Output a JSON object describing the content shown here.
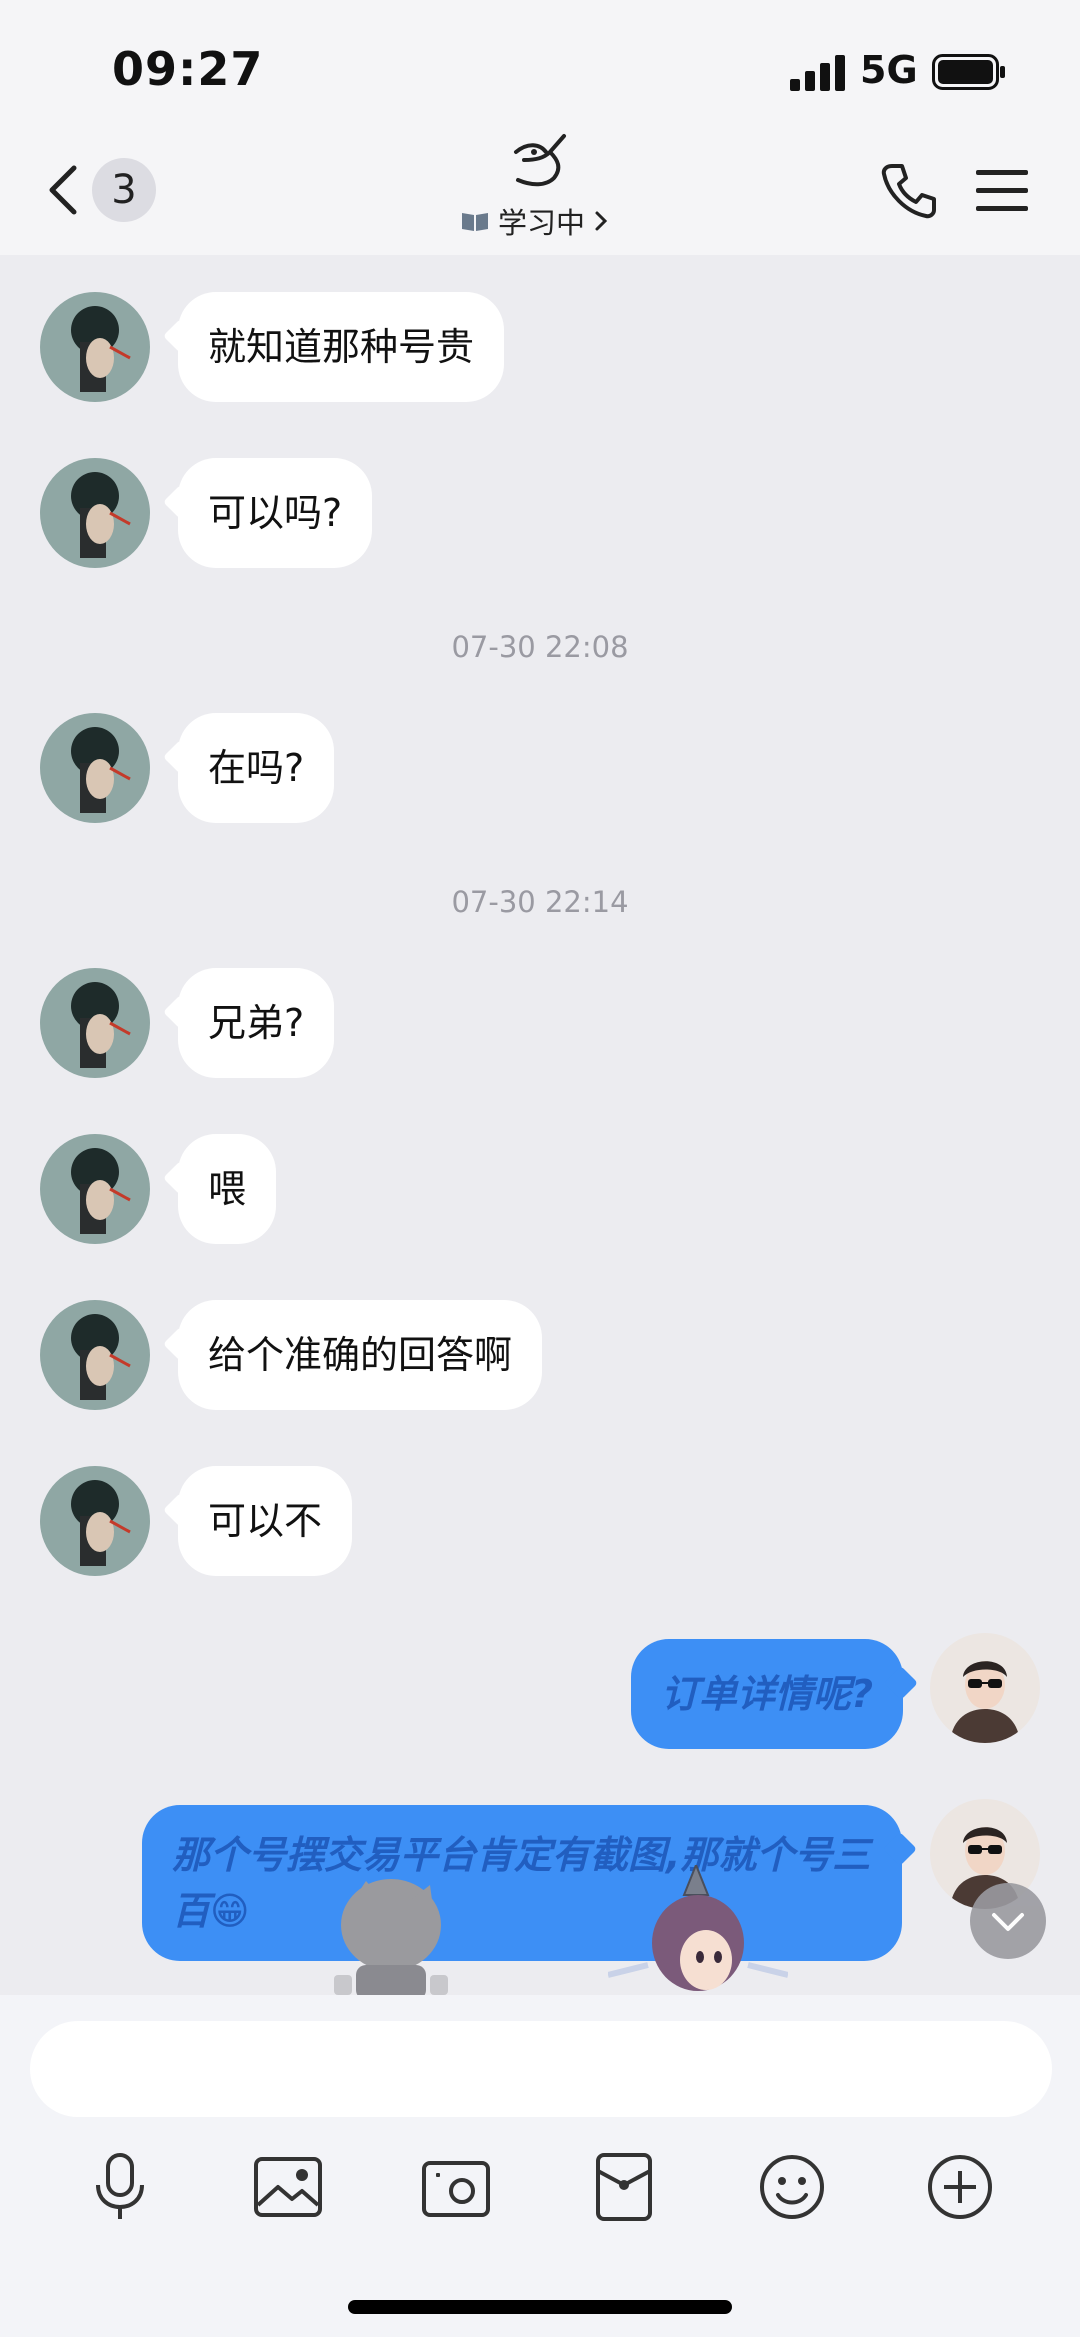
{
  "status_bar": {
    "time": "09:27",
    "network": "5G"
  },
  "header": {
    "unread_count": "3",
    "status_text": "学习中"
  },
  "messages": [
    {
      "text": "就知道那种号贵"
    },
    {
      "text": "可以吗?"
    },
    {
      "timestamp": "07-30 22:08"
    },
    {
      "text": "在吗?"
    },
    {
      "timestamp": "07-30 22:14"
    },
    {
      "text": "兄弟?"
    },
    {
      "text": "喂"
    },
    {
      "text": "给个准确的回答啊"
    },
    {
      "text": "可以不"
    },
    {
      "text": "订单详情呢?"
    },
    {
      "text": "那个号摆交易平台肯定有截图,那就个号三百😁"
    }
  ],
  "colors": {
    "outgoing_bubble": "#3d8ff5",
    "background": "#ececf0"
  },
  "icons": [
    "back-chevron-icon",
    "phone-icon",
    "menu-icon",
    "microphone-icon",
    "image-icon",
    "camera-icon",
    "red-packet-icon",
    "emoji-icon",
    "add-icon",
    "scroll-down-icon"
  ]
}
